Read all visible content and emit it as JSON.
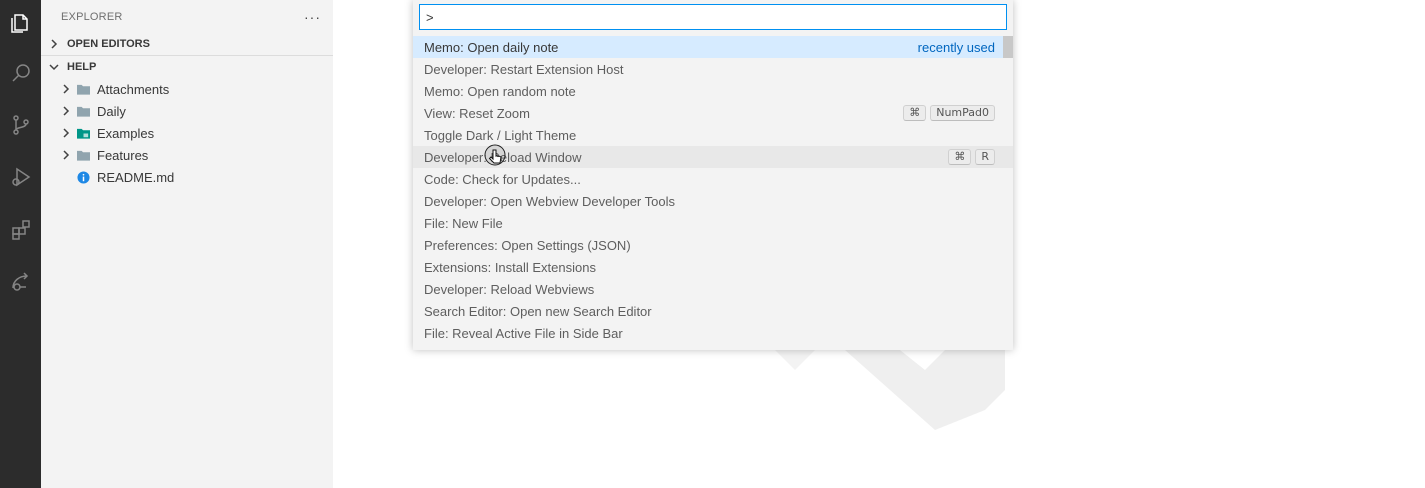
{
  "sidebar": {
    "title": "EXPLORER",
    "more_label": "···",
    "sections": {
      "open_editors": "OPEN EDITORS",
      "help": "HELP"
    },
    "items": [
      {
        "label": "Attachments",
        "kind": "folder",
        "icon": "folder-icon"
      },
      {
        "label": "Daily",
        "kind": "folder",
        "icon": "folder-icon"
      },
      {
        "label": "Examples",
        "kind": "folder",
        "icon": "folder-special-icon"
      },
      {
        "label": "Features",
        "kind": "folder",
        "icon": "folder-icon"
      },
      {
        "label": "README.md",
        "kind": "file",
        "icon": "info-icon"
      }
    ]
  },
  "palette": {
    "input_value": ">",
    "commands": [
      {
        "label": "Memo: Open daily note",
        "badge": "recently used"
      },
      {
        "label": "Developer: Restart Extension Host"
      },
      {
        "label": "Memo: Open random note"
      },
      {
        "label": "View: Reset Zoom",
        "keys": [
          "⌘",
          "NumPad0"
        ]
      },
      {
        "label": "Toggle Dark / Light Theme"
      },
      {
        "label": "Developer: Reload Window",
        "keys": [
          "⌘",
          "R"
        ]
      },
      {
        "label": "Code: Check for Updates..."
      },
      {
        "label": "Developer: Open Webview Developer Tools"
      },
      {
        "label": "File: New File"
      },
      {
        "label": "Preferences: Open Settings (JSON)"
      },
      {
        "label": "Extensions: Install Extensions"
      },
      {
        "label": "Developer: Reload Webviews"
      },
      {
        "label": "Search Editor: Open new Search Editor"
      },
      {
        "label": "File: Reveal Active File in Side Bar"
      }
    ]
  },
  "colors": {
    "accent": "#0090f1",
    "selection": "#d6ebff",
    "activity_bar": "#2c2c2c",
    "sidebar_bg": "#f3f3f3",
    "folder": "#90a4ae",
    "info": "#1e88e5",
    "special_folder": "#009688"
  }
}
